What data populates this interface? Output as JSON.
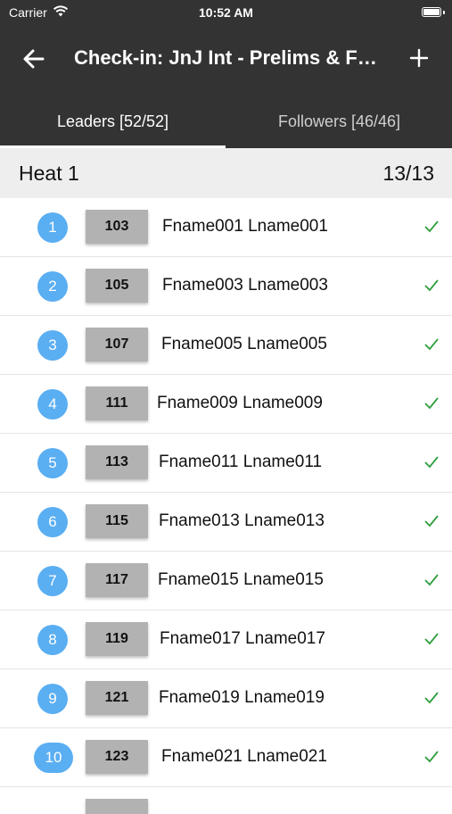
{
  "status_bar": {
    "carrier": "Carrier",
    "time": "10:52 AM",
    "wifi_icon": "wifi-icon",
    "battery_icon": "battery-icon"
  },
  "nav": {
    "back_icon": "arrow-left-icon",
    "title": "Check-in: JnJ Int - Prelims & Finals",
    "add_icon": "plus-icon"
  },
  "tabs": [
    {
      "label": "Leaders [52/52]",
      "selected": true
    },
    {
      "label": "Followers [46/46]",
      "selected": false
    }
  ],
  "section": {
    "title": "Heat 1",
    "count": "13/13"
  },
  "colors": {
    "header_bg": "#333333",
    "badge_bg": "#5aaef2",
    "bib_bg": "#b2b2b2",
    "check_color": "#2e9e3e"
  },
  "rows": [
    {
      "index": "1",
      "bib": "103",
      "name": "Fname001 Lname001",
      "checked": true
    },
    {
      "index": "2",
      "bib": "105",
      "name": "Fname003 Lname003",
      "checked": true
    },
    {
      "index": "3",
      "bib": "107",
      "name": "Fname005 Lname005",
      "checked": true
    },
    {
      "index": "4",
      "bib": "111",
      "name": "Fname009 Lname009",
      "checked": true
    },
    {
      "index": "5",
      "bib": "113",
      "name": "Fname011 Lname011",
      "checked": true
    },
    {
      "index": "6",
      "bib": "115",
      "name": "Fname013 Lname013",
      "checked": true
    },
    {
      "index": "7",
      "bib": "117",
      "name": "Fname015 Lname015",
      "checked": true
    },
    {
      "index": "8",
      "bib": "119",
      "name": "Fname017 Lname017",
      "checked": true
    },
    {
      "index": "9",
      "bib": "121",
      "name": "Fname019 Lname019",
      "checked": true
    },
    {
      "index": "10",
      "bib": "123",
      "name": "Fname021 Lname021",
      "checked": true
    }
  ]
}
